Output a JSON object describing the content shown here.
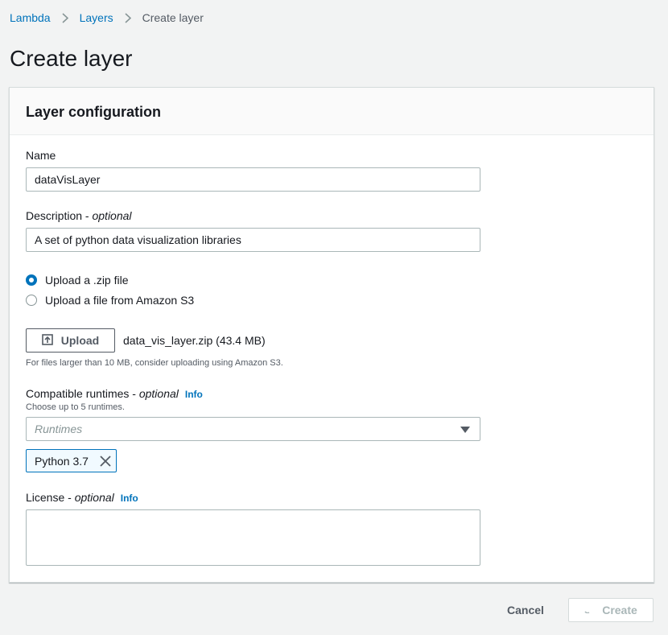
{
  "breadcrumb": {
    "items": [
      "Lambda",
      "Layers"
    ],
    "current": "Create layer"
  },
  "page": {
    "title": "Create layer"
  },
  "panel": {
    "title": "Layer configuration",
    "name": {
      "label": "Name",
      "value": "dataVisLayer"
    },
    "description": {
      "label": "Description",
      "optional": "optional",
      "value": "A set of python data visualization libraries"
    },
    "upload_source": {
      "options": [
        "Upload a .zip file",
        "Upload a file from Amazon S3"
      ],
      "selected": "Upload a .zip file"
    },
    "upload": {
      "button_label": "Upload",
      "file_name": "data_vis_layer.zip (43.4 MB)",
      "hint": "For files larger than 10 MB, consider uploading using Amazon S3."
    },
    "runtimes": {
      "label": "Compatible runtimes",
      "optional": "optional",
      "info": "Info",
      "hint": "Choose up to 5 runtimes.",
      "placeholder": "Runtimes",
      "selected": [
        "Python 3.7"
      ]
    },
    "license": {
      "label": "License",
      "optional": "optional",
      "info": "Info",
      "value": ""
    }
  },
  "footer": {
    "cancel_label": "Cancel",
    "create_label": "Create"
  },
  "colors": {
    "accent": "#0073bb",
    "text": "#16191f",
    "muted": "#545b64",
    "disabled": "#aab7b8",
    "background": "#f2f3f3"
  },
  "icons": [
    "chevron-right-icon",
    "upload-icon",
    "caret-down-icon",
    "close-icon",
    "spinner-icon",
    "resize-grip-icon"
  ]
}
